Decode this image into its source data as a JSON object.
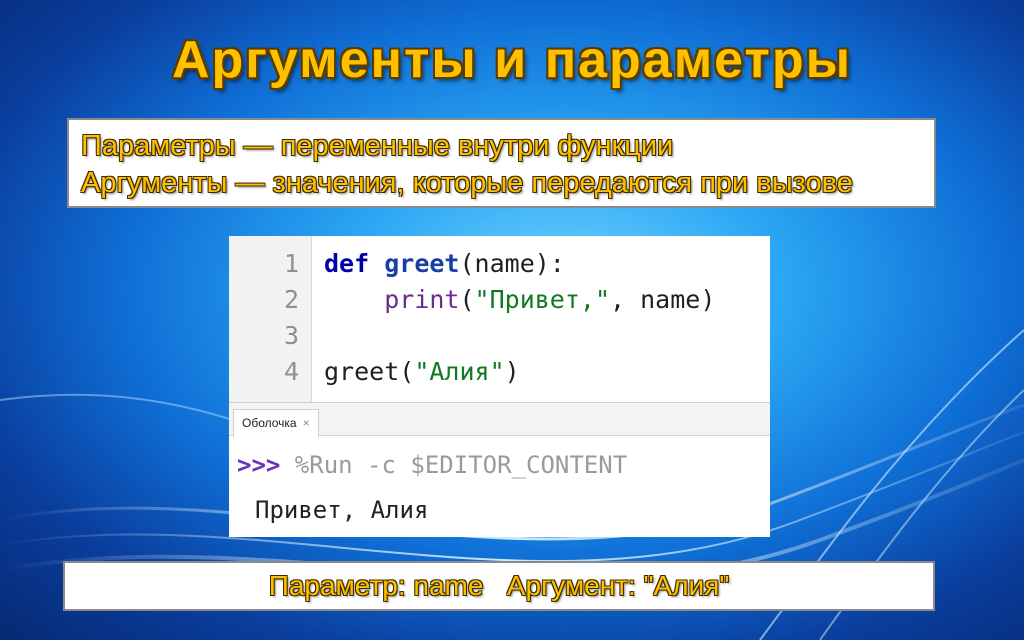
{
  "slide": {
    "title": "Аргументы и параметры",
    "definitions": [
      "Параметры — переменные внутри функции",
      "Аргументы — значения, которые передаются при вызове"
    ],
    "summary": "Параметр: name   Аргумент: \"Алия\""
  },
  "editor": {
    "line_numbers": [
      "1",
      "2",
      "3",
      "4"
    ],
    "line1": {
      "kw": "def",
      "fn": "greet",
      "rest": "(name):"
    },
    "line2": {
      "indent": "    ",
      "builtin": "print",
      "open": "(",
      "str": "\"Привет,\"",
      "rest": ", name)"
    },
    "line4": {
      "call": "greet(",
      "str": "\"Алия\"",
      "close": ")"
    }
  },
  "shell": {
    "tab_label": "Оболочка",
    "tab_close": "×",
    "prompt": ">>>",
    "command": " %Run -c $EDITOR_CONTENT",
    "output": "Привет, Алия"
  },
  "colors": {
    "title_fill": "#ffc000",
    "keyword": "#0000aa",
    "string": "#117a22",
    "builtin": "#6a2c91",
    "prompt": "#6a33b8"
  }
}
